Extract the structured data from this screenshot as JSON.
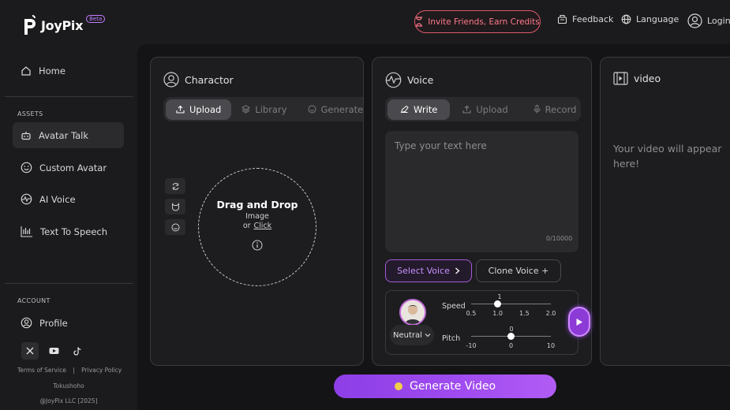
{
  "brand": {
    "name": "JoyPix",
    "badge": "Beta"
  },
  "header": {
    "invite_label": "Invite Friends, Earn Credits",
    "feedback_label": "Feedback",
    "language_label": "Language",
    "login_label": "Login"
  },
  "sidebar": {
    "home_label": "Home",
    "assets_section": "ASSETS",
    "assets": [
      {
        "label": "Avatar Talk",
        "icon": "robot-icon",
        "active": true
      },
      {
        "label": "Custom Avatar",
        "icon": "smile-icon",
        "active": false
      },
      {
        "label": "AI Voice",
        "icon": "voice-wave-icon",
        "active": false
      },
      {
        "label": "Text To Speech",
        "icon": "waveform-icon",
        "active": false
      }
    ],
    "account_section": "ACCOUNT",
    "profile_label": "Profile",
    "social": [
      "x-icon",
      "youtube-icon",
      "tiktok-icon"
    ],
    "terms_label": "Terms of Service",
    "separator": "|",
    "privacy_label": "Privacy Policy",
    "tokushoho_label": "Tokushoho",
    "copyright": "@JoyPix LLC [2025]"
  },
  "character_panel": {
    "title": "Charactor",
    "tabs": [
      {
        "label": "Upload",
        "active": true
      },
      {
        "label": "Library",
        "active": false
      },
      {
        "label": "Generated",
        "active": false
      }
    ],
    "drop_title": "Drag and Drop",
    "drop_sub": "Image",
    "drop_or": "or",
    "drop_click": "Click"
  },
  "voice_panel": {
    "title": "Voice",
    "tabs": [
      {
        "label": "Write",
        "active": true
      },
      {
        "label": "Upload",
        "active": false
      },
      {
        "label": "Record",
        "active": false
      }
    ],
    "text_placeholder": "Type your text here",
    "text_value": "",
    "counter": "0/10000",
    "select_voice_label": "Select Voice",
    "clone_voice_label": "Clone Voice +",
    "emotion_label": "Neutral",
    "speed": {
      "label": "Speed",
      "value": 1.0,
      "value_label": "1",
      "min": 0.5,
      "max": 2.0,
      "ticks": [
        "0.5",
        "1.0",
        "1.5",
        "2.0"
      ]
    },
    "pitch": {
      "label": "Pitch",
      "value": 0,
      "value_label": "0",
      "min": -10,
      "max": 10,
      "ticks": [
        "-10",
        "0",
        "10"
      ]
    }
  },
  "video_panel": {
    "title": "video",
    "placeholder": "Your video will appear here!"
  },
  "generate_label": "Generate Video",
  "colors": {
    "accent": "#a04cf0",
    "invite": "#e0586b",
    "indicator": "#f2cf4a"
  }
}
